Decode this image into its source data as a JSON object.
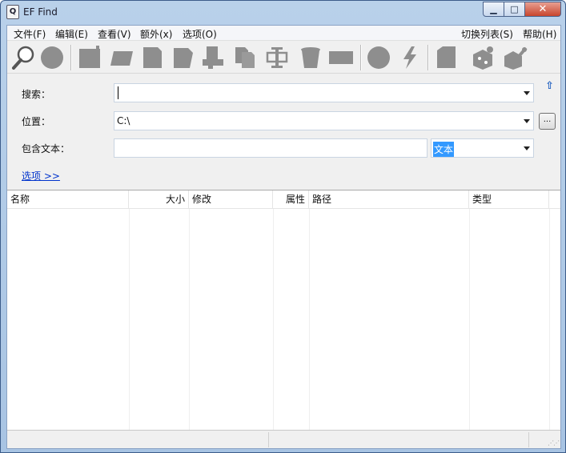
{
  "window": {
    "title": "EF Find",
    "app_icon_glyph": "Q"
  },
  "window_buttons": {
    "minimize": "▁",
    "maximize": "□",
    "close": "✕"
  },
  "menu": {
    "left": [
      "文件(F)",
      "编辑(E)",
      "查看(V)",
      "额外(x)",
      "选项(O)"
    ],
    "right": [
      "切换列表(S)",
      "帮助(H)"
    ]
  },
  "toolbar": {
    "icons": [
      "search-icon",
      "stop-icon",
      "new-icon",
      "open-icon",
      "document-icon",
      "edit-icon",
      "cut-icon",
      "copy-icon",
      "paste-icon",
      "delete-icon",
      "rename-icon",
      "circle-icon",
      "lightning-icon",
      "file-icon",
      "settings-icon",
      "tools-icon"
    ]
  },
  "form": {
    "search_label": "搜索：",
    "search_value": "",
    "location_label": "位置：",
    "location_value": "C:\\",
    "browse_label": "...",
    "contains_label": "包含文本：",
    "contains_value": "",
    "text_mode_value": "文本",
    "options_link": "选项 >>"
  },
  "list": {
    "columns": [
      "名称",
      "大小",
      "修改",
      "属性",
      "路径",
      "类型"
    ]
  },
  "colors": {
    "accent": "#3399ff",
    "link": "#0033cc",
    "icon_gray": "#8e8e8e"
  }
}
